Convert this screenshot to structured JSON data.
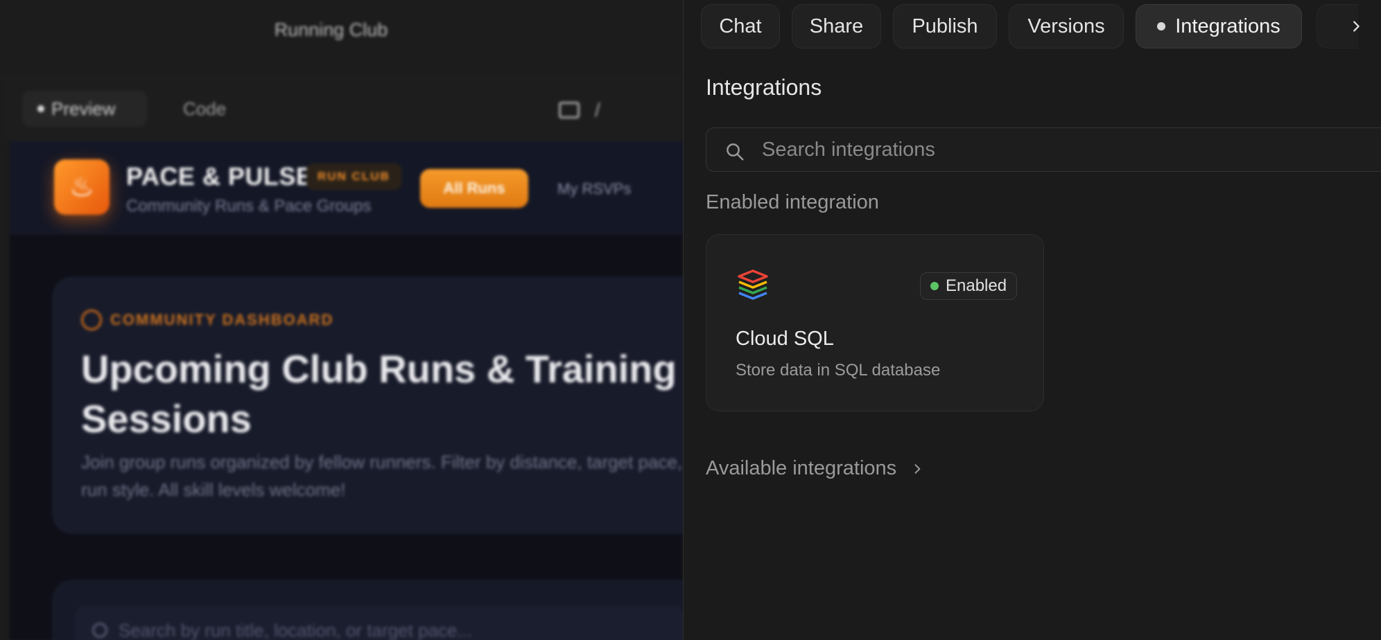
{
  "background_app": {
    "project_title": "Running Club",
    "toolbar": {
      "preview_label": "Preview",
      "code_label": "Code",
      "path_separator": "/"
    },
    "app": {
      "brand_name": "PACE & PULSE",
      "brand_badge": "RUN CLUB",
      "brand_subtitle": "Community Runs & Pace Groups",
      "nav": {
        "active_label": "All Runs",
        "second_label": "My RSVPs"
      },
      "hero": {
        "tag": "COMMUNITY DASHBOARD",
        "title": "Upcoming Club Runs & Training Sessions",
        "description": "Join group runs organized by fellow runners. Filter by distance, target pace, or run style. All skill levels welcome!"
      },
      "search_placeholder": "Search by run title, location, or target pace..."
    }
  },
  "panel": {
    "tabs": [
      {
        "label": "Chat"
      },
      {
        "label": "Share"
      },
      {
        "label": "Publish"
      },
      {
        "label": "Versions"
      },
      {
        "label": "Integrations",
        "active": true
      }
    ],
    "title": "Integrations",
    "search": {
      "placeholder": "Search integrations",
      "value": ""
    },
    "enabled_section_label": "Enabled integration",
    "enabled_integrations": [
      {
        "name": "Cloud SQL",
        "description": "Store data in SQL database",
        "status": "Enabled",
        "status_color": "#5cc465",
        "icon": "cloud-sql-layers-icon"
      }
    ],
    "available_section_label": "Available integrations"
  },
  "colors": {
    "panel_bg": "#1b1b1b",
    "accent_orange": "#f08c2a",
    "enabled_green": "#5cc465"
  }
}
